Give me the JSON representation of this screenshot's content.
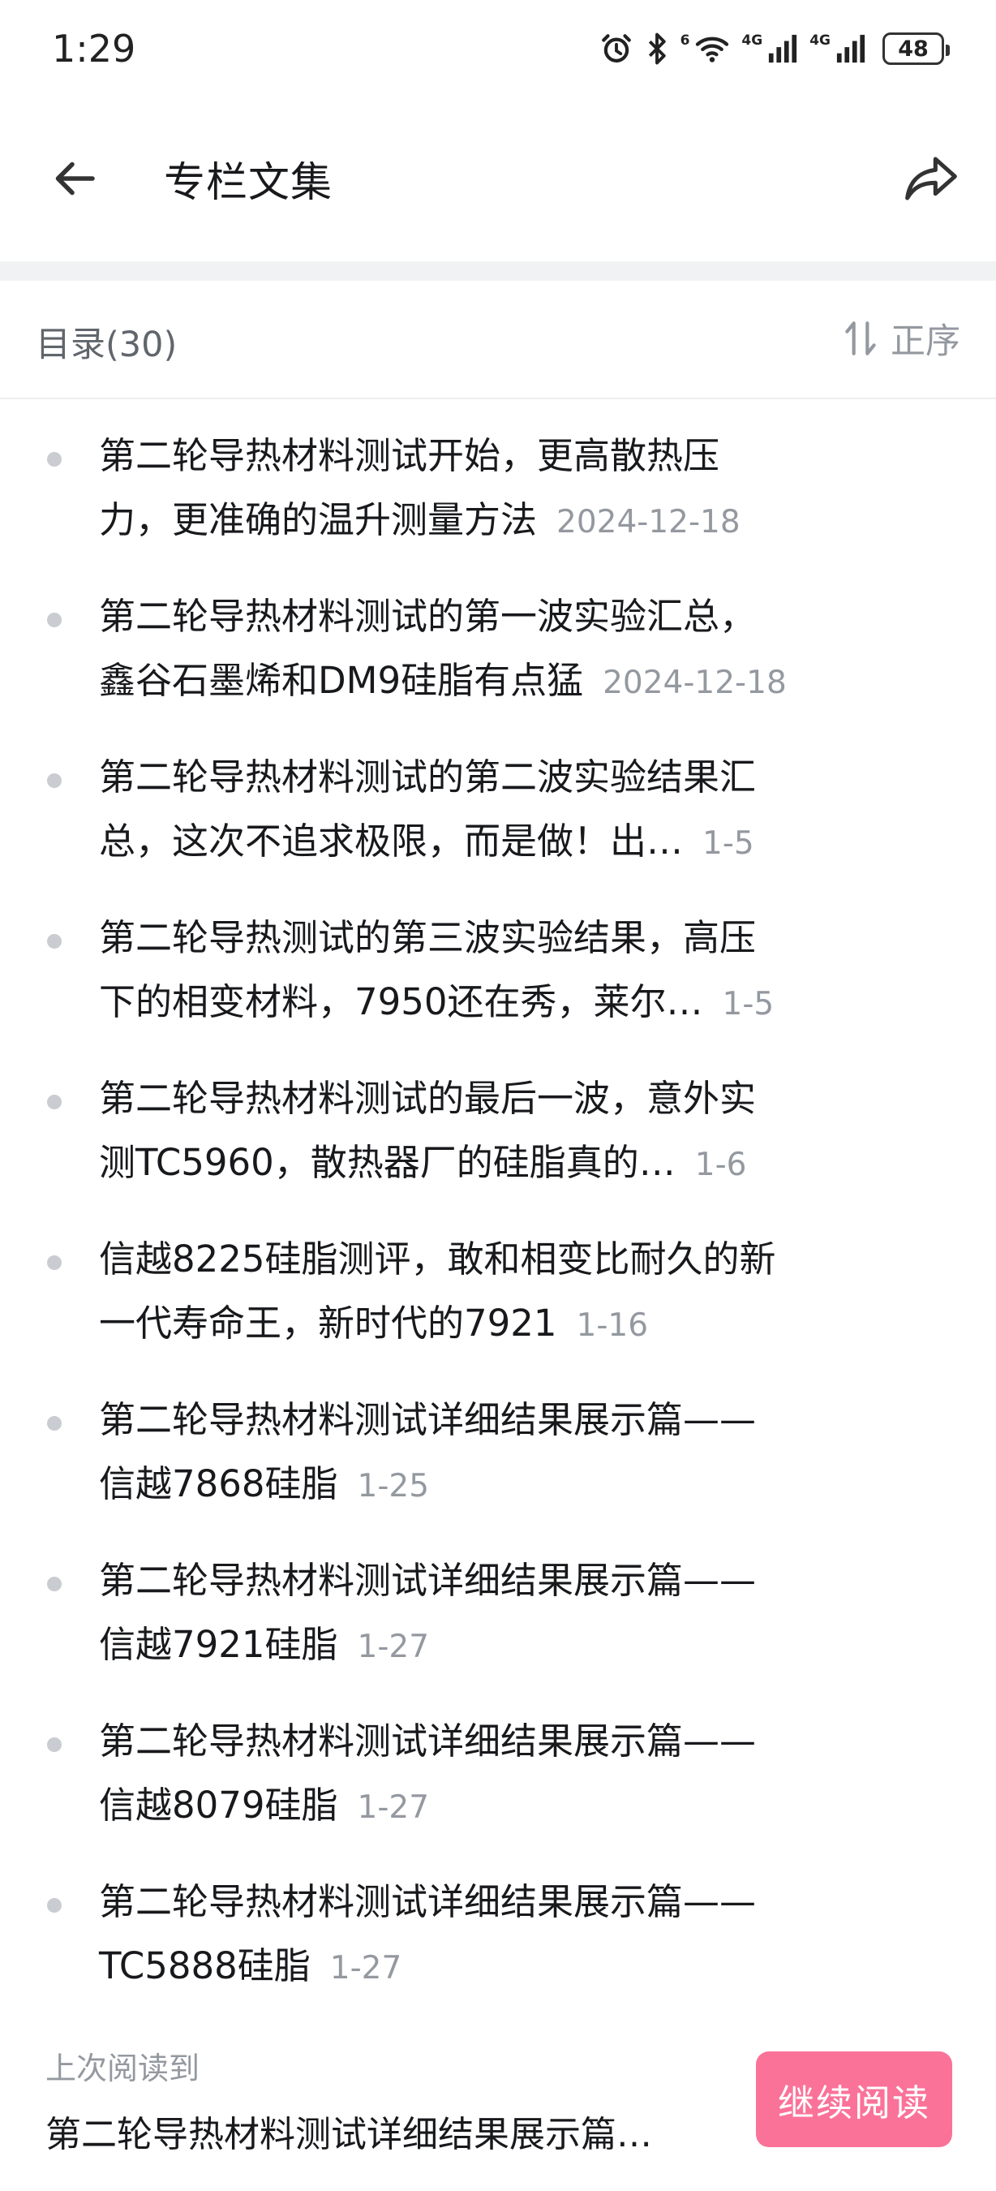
{
  "status_bar": {
    "time": "1:29",
    "battery": "48",
    "signal_labels": [
      "4G",
      "4G"
    ],
    "wifi_label": "6"
  },
  "header": {
    "title": "专栏文集"
  },
  "toc": {
    "count_label": "目录(30)",
    "sort_label": "正序"
  },
  "articles": [
    {
      "line1": "第二轮导热材料测试开始，更高散热压",
      "line2": "力，更准确的温升测量方法",
      "date": "2024-12-18"
    },
    {
      "line1": "第二轮导热材料测试的第一波实验汇总，",
      "line2": "鑫谷石墨烯和DM9硅脂有点猛",
      "date": "2024-12-18"
    },
    {
      "line1": "第二轮导热材料测试的第二波实验结果汇",
      "line2": "总，这次不追求极限，而是做！出…",
      "date": "1-5"
    },
    {
      "line1": "第二轮导热测试的第三波实验结果，高压",
      "line2": "下的相变材料，7950还在秀，莱尔…",
      "date": "1-5"
    },
    {
      "line1": "第二轮导热材料测试的最后一波，意外实",
      "line2": "测TC5960，散热器厂的硅脂真的…",
      "date": "1-6"
    },
    {
      "line1": "信越8225硅脂测评，敢和相变比耐久的新",
      "line2": "一代寿命王，新时代的7921",
      "date": "1-16"
    },
    {
      "line1": "第二轮导热材料测试详细结果展示篇——",
      "line2": "信越7868硅脂",
      "date": "1-25"
    },
    {
      "line1": "第二轮导热材料测试详细结果展示篇——",
      "line2": "信越7921硅脂",
      "date": "1-27"
    },
    {
      "line1": "第二轮导热材料测试详细结果展示篇——",
      "line2": "信越8079硅脂",
      "date": "1-27"
    },
    {
      "line1": "第二轮导热材料测试详细结果展示篇——",
      "line2": "TC5888硅脂",
      "date": "1-27"
    }
  ],
  "resume": {
    "label": "上次阅读到",
    "title": "第二轮导热材料测试详细结果展示篇…",
    "button": "继续阅读"
  },
  "colors": {
    "accent": "#fb7299",
    "text_primary": "#18191c",
    "text_secondary": "#9499a0"
  }
}
